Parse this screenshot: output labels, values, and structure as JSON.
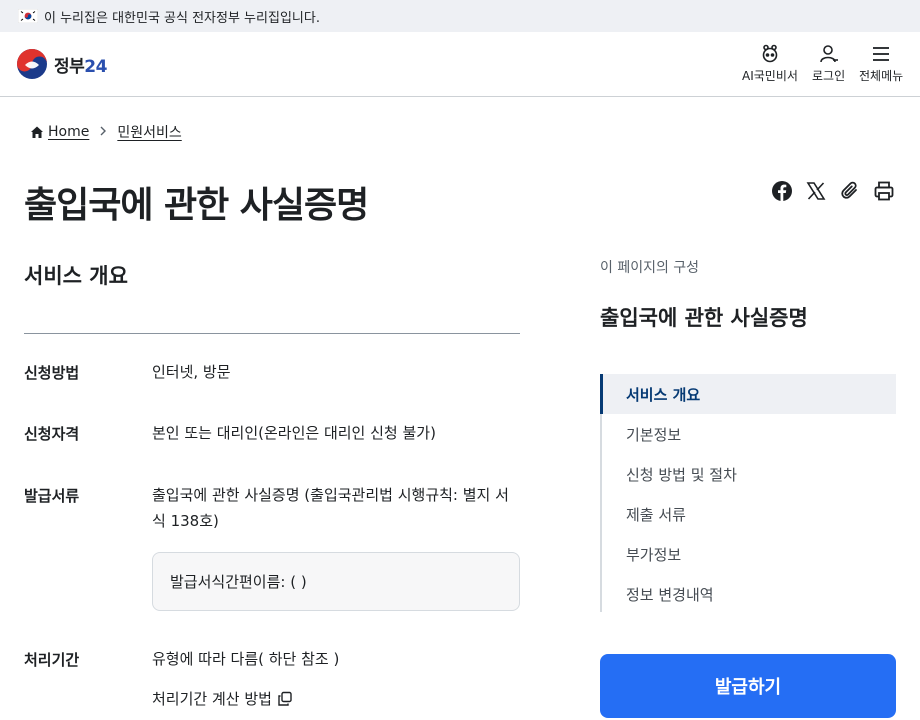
{
  "banner": {
    "text": "이 누리집은 대한민국 공식 전자정부 누리집입니다.",
    "flag_icon": "korea-flag-icon"
  },
  "header": {
    "logo": {
      "name": "정부",
      "number": "24",
      "brand_color": "#2a4fae"
    },
    "utilities": [
      {
        "label": "AI국민비서",
        "icon": "ai-assistant-icon"
      },
      {
        "label": "로그인",
        "icon": "user-icon"
      },
      {
        "label": "전체메뉴",
        "icon": "menu-icon"
      }
    ]
  },
  "breadcrumb": {
    "home": "Home",
    "current": "민원서비스"
  },
  "page_title": "출입국에 관한 사실증명",
  "share_icons": [
    "facebook-icon",
    "x-icon",
    "link-clip-icon",
    "print-icon"
  ],
  "overview": {
    "title": "서비스 개요",
    "rows": [
      {
        "label": "신청방법",
        "value": "인터넷, 방문"
      },
      {
        "label": "신청자격",
        "value": "본인 또는 대리인(온라인은 대리인 신청 불가)"
      },
      {
        "label": "발급서류",
        "value": "출입국에 관한 사실증명 (출입국관리법 시행규칙: 별지 서식 138호)"
      },
      {
        "label": "처리기간",
        "value": "유형에 따라 다름( 하단 참조 )"
      }
    ],
    "form_box": "발급서식간편이름: ( )",
    "calc_link": "처리기간 계산 방법"
  },
  "toc": {
    "caption": "이 페이지의 구성",
    "title": "출입국에 관한 사실증명",
    "items": [
      "서비스 개요",
      "기본정보",
      "신청 방법 및 절차",
      "제출 서류",
      "부가정보",
      "정보 변경내역"
    ],
    "active_index": 0
  },
  "issue_button": {
    "label": "발급하기",
    "color": "#256ef4"
  }
}
